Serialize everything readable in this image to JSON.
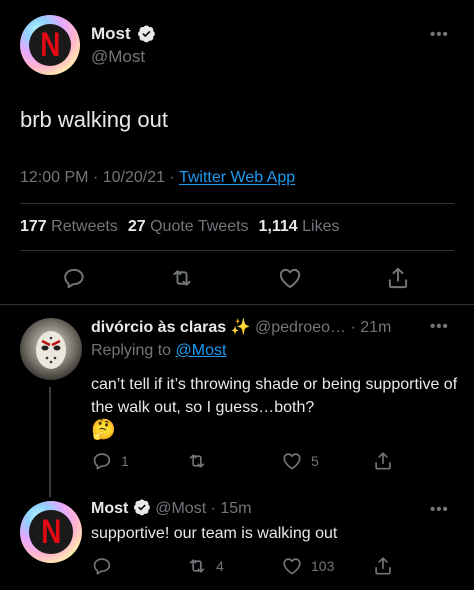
{
  "main_tweet": {
    "author_name": "Most",
    "author_handle": "@Most",
    "text": "brb walking out",
    "time": "12:00 PM",
    "date": "10/20/21",
    "separator": "·",
    "source": "Twitter Web App",
    "stats": {
      "retweets_count": "177",
      "retweets_label": "Retweets",
      "quote_count": "27",
      "quote_label": "Quote Tweets",
      "likes_count": "1,114",
      "likes_label": "Likes"
    }
  },
  "reply_1": {
    "author_name": "divórcio às claras",
    "sparkle": "✨",
    "author_handle": "@pedroeo…",
    "time": "· 21m",
    "replying_prefix": "Replying to",
    "replying_to": "@Most",
    "text": "can’t tell if it’s throwing shade or being supportive of the walk out, so I guess…both?",
    "emoji": "🤔",
    "reply_count": "1",
    "retweet_count": "",
    "like_count": "5"
  },
  "reply_2": {
    "author_name": "Most",
    "author_handle": "@Most",
    "time": "· 15m",
    "text": "supportive! our team is walking out",
    "reply_count": "",
    "retweet_count": "4",
    "like_count": "103"
  },
  "more_label": "•••",
  "colors": {
    "background": "#000000",
    "text": "#e7e9ea",
    "muted": "#71767b",
    "link": "#1d9bf0",
    "divider": "#2f3336",
    "netflix_red": "#e50914"
  }
}
